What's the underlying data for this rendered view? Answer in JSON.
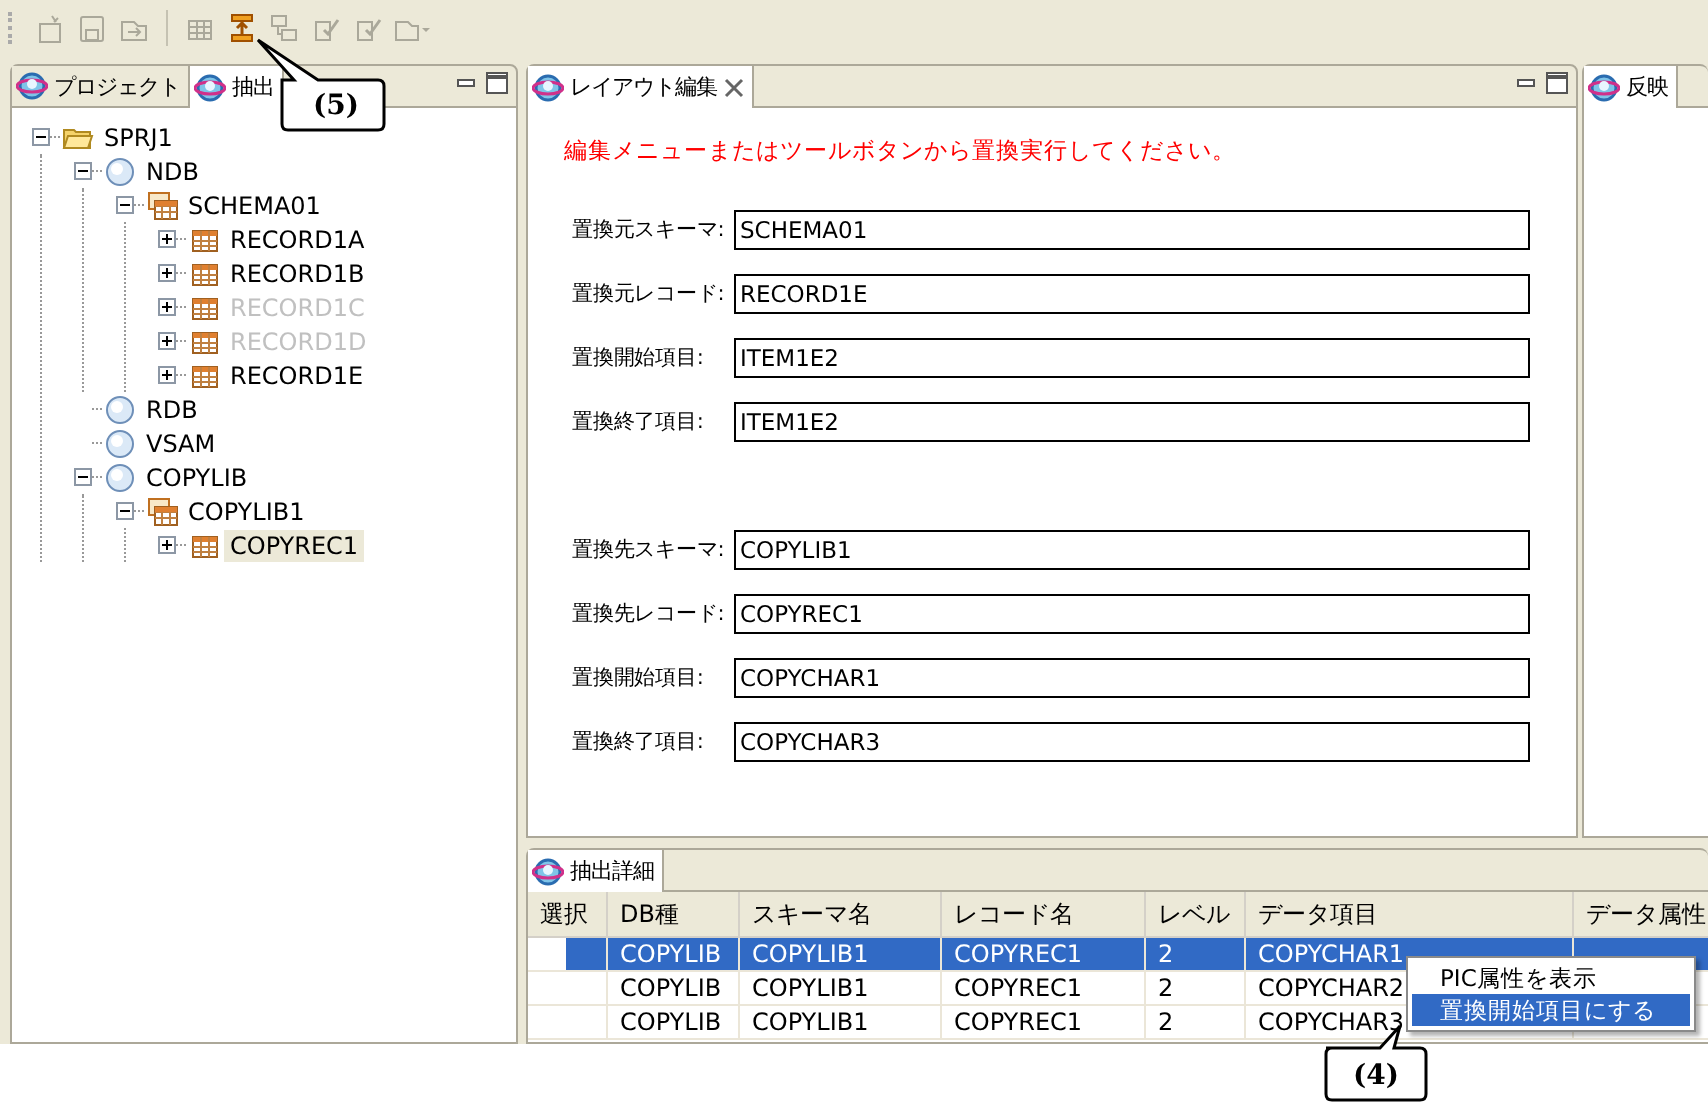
{
  "toolbar": {
    "buttons": [
      {
        "kind": "new",
        "disabled": true
      },
      {
        "kind": "save",
        "disabled": true
      },
      {
        "kind": "export",
        "disabled": true
      },
      {
        "kind": "grid",
        "disabled": true
      },
      {
        "kind": "replace",
        "disabled": false
      },
      {
        "kind": "schema",
        "disabled": true
      },
      {
        "kind": "check",
        "disabled": true
      },
      {
        "kind": "check",
        "disabled": true
      },
      {
        "kind": "dropdown",
        "disabled": true
      }
    ]
  },
  "left_panel": {
    "tabs": [
      {
        "label": "プロジェクト",
        "selected": false
      },
      {
        "label": "抽出",
        "selected": true
      }
    ],
    "tree": [
      {
        "label": "SPRJ1",
        "kind": "folder",
        "expanded": true,
        "disabled": false,
        "selected": false,
        "children": [
          {
            "label": "NDB",
            "kind": "database",
            "expanded": true,
            "disabled": false,
            "selected": false,
            "children": [
              {
                "label": "SCHEMA01",
                "kind": "schema",
                "expanded": true,
                "disabled": false,
                "selected": false,
                "children": [
                  {
                    "label": "RECORD1A",
                    "kind": "record",
                    "expanded": false,
                    "disabled": false,
                    "selected": false
                  },
                  {
                    "label": "RECORD1B",
                    "kind": "record",
                    "expanded": false,
                    "disabled": false,
                    "selected": false
                  },
                  {
                    "label": "RECORD1C",
                    "kind": "record",
                    "expanded": false,
                    "disabled": true,
                    "selected": false
                  },
                  {
                    "label": "RECORD1D",
                    "kind": "record",
                    "expanded": false,
                    "disabled": true,
                    "selected": false
                  },
                  {
                    "label": "RECORD1E",
                    "kind": "record",
                    "expanded": false,
                    "disabled": false,
                    "selected": false
                  }
                ]
              }
            ]
          },
          {
            "label": "RDB",
            "kind": "database",
            "disabled": false,
            "selected": false
          },
          {
            "label": "VSAM",
            "kind": "database",
            "disabled": false,
            "selected": false
          },
          {
            "label": "COPYLIB",
            "kind": "database",
            "expanded": true,
            "disabled": false,
            "selected": false,
            "children": [
              {
                "label": "COPYLIB1",
                "kind": "schema",
                "expanded": true,
                "disabled": false,
                "selected": false,
                "children": [
                  {
                    "label": "COPYREC1",
                    "kind": "record",
                    "expanded": false,
                    "disabled": false,
                    "selected": true
                  }
                ]
              }
            ]
          }
        ]
      }
    ]
  },
  "editor": {
    "tab": {
      "label": "レイアウト編集"
    },
    "message": "編集メニューまたはツールボタンから置換実行してください。",
    "groups": [
      [
        {
          "label": "置換元スキーマ:",
          "value": "SCHEMA01"
        },
        {
          "label": "置換元レコード:",
          "value": "RECORD1E"
        },
        {
          "label": "置換開始項目:",
          "value": "ITEM1E2"
        },
        {
          "label": "置換終了項目:",
          "value": "ITEM1E2"
        }
      ],
      [
        {
          "label": "置換先スキーマ:",
          "value": "COPYLIB1"
        },
        {
          "label": "置換先レコード:",
          "value": "COPYREC1"
        },
        {
          "label": "置換開始項目:",
          "value": "COPYCHAR1"
        },
        {
          "label": "置換終了項目:",
          "value": "COPYCHAR3"
        }
      ]
    ]
  },
  "side_panel": {
    "tab": {
      "label": "反映"
    }
  },
  "detail_panel": {
    "tab": {
      "label": "抽出詳細"
    },
    "table": {
      "columns": [
        "選択",
        "DB種",
        "スキーマ名",
        "レコード名",
        "レベル",
        "データ項目",
        "データ属性"
      ],
      "rows": [
        {
          "selected": true,
          "cells": [
            "",
            "COPYLIB",
            "COPYLIB1",
            "COPYREC1",
            "2",
            "COPYCHAR1"
          ]
        },
        {
          "selected": false,
          "cells": [
            "",
            "COPYLIB",
            "COPYLIB1",
            "COPYREC1",
            "2",
            "COPYCHAR2"
          ]
        },
        {
          "selected": false,
          "cells": [
            "",
            "COPYLIB",
            "COPYLIB1",
            "COPYREC1",
            "2",
            "COPYCHAR3"
          ]
        }
      ]
    },
    "context_menu": [
      {
        "label": "PIC属性を表示",
        "selected": false
      },
      {
        "label": "置換開始項目にする",
        "selected": true
      }
    ]
  },
  "callouts": [
    {
      "label": "(5)"
    },
    {
      "label": "(4)"
    }
  ]
}
